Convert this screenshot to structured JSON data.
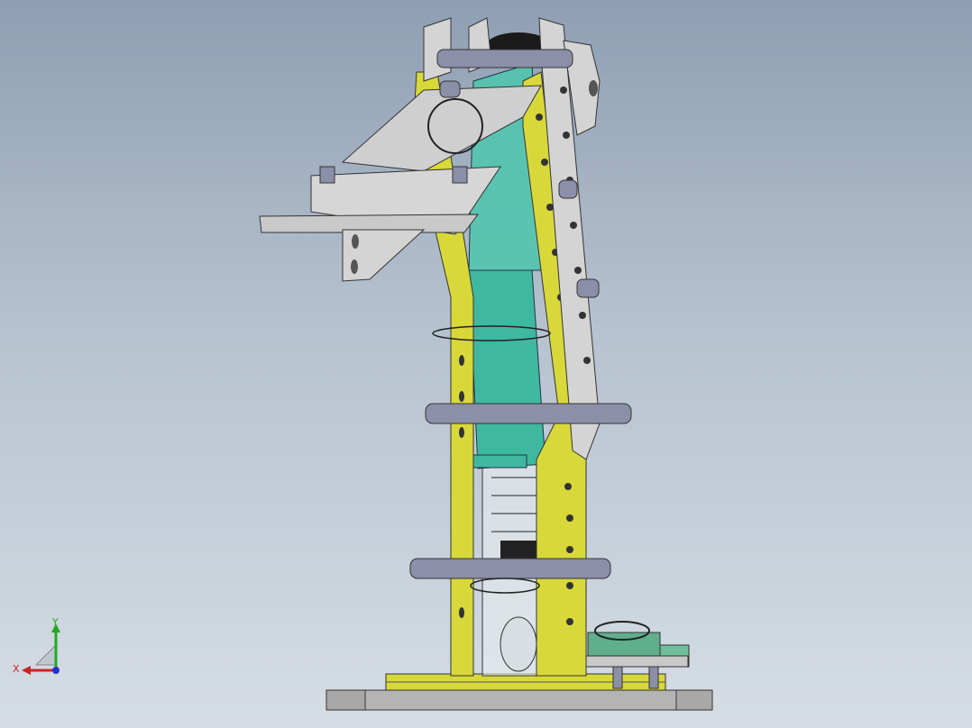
{
  "window": {
    "background_top": "#8e9fb3",
    "background_bottom": "#d6dde4"
  },
  "model": {
    "part_colors": {
      "yellow_plate": "#d8d83a",
      "gray_plate": "#c9c9c9",
      "teal_cylinder": "#3fb8a0",
      "steel_pin": "#8c8fa8",
      "base_plate": "#a8a8a8",
      "motor": "#5fae8c"
    }
  },
  "triad": {
    "x_label": "X",
    "y_label": "Y",
    "x_color": "#cc2222",
    "y_color": "#22aa22",
    "z_color": "#2233cc"
  }
}
